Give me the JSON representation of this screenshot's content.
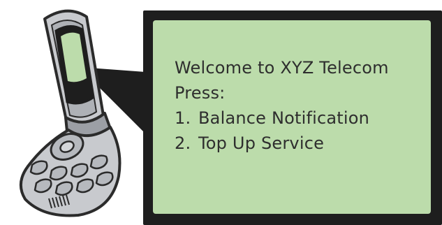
{
  "message": {
    "welcome": "Welcome to XYZ Telecom",
    "prompt": "Press:",
    "options": [
      {
        "number": "1.",
        "label": "Balance Notification"
      },
      {
        "number": "2.",
        "label": "Top Up Service"
      }
    ]
  },
  "colors": {
    "screen_green": "#bcdcab",
    "frame_black": "#1e1e1e",
    "phone_silver": "#c8cace",
    "phone_dark": "#2b2b2b"
  },
  "icons": {
    "phone": "flip-phone-icon"
  }
}
